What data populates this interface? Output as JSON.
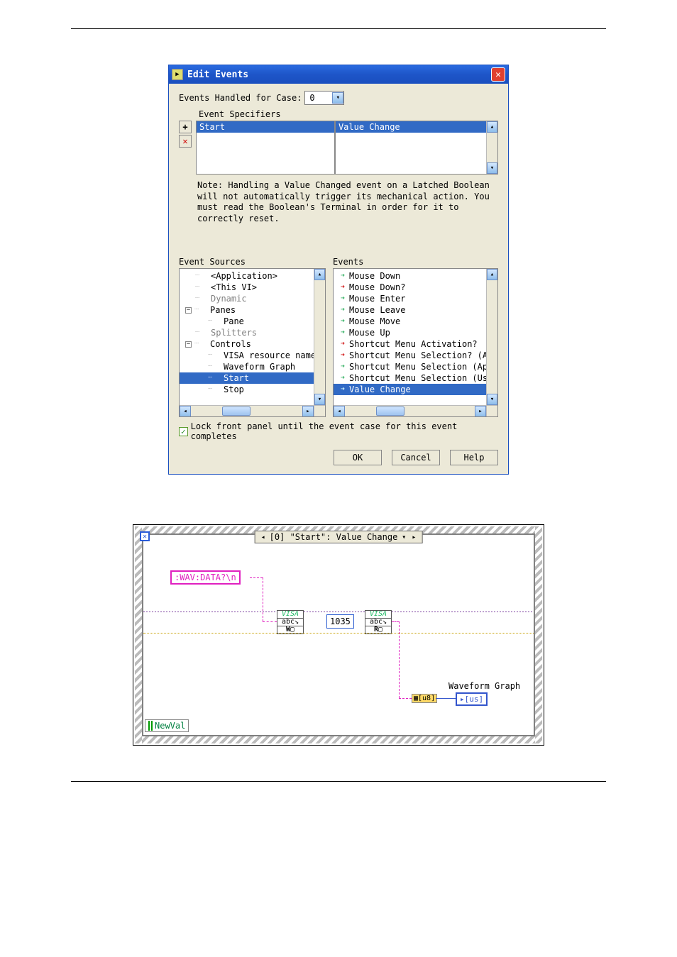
{
  "dialog": {
    "title": "Edit Events",
    "handled_label": "Events Handled for Case:",
    "case_value": "0",
    "spec_label": "Event Specifiers",
    "spec_col1": "Start",
    "spec_col2": "Value Change",
    "note": "Note:  Handling a Value Changed event on a Latched Boolean will not automatically trigger its mechanical action. You must read the Boolean's Terminal in order for it to correctly reset.",
    "sources_label": "Event Sources",
    "events_label": "Events",
    "tree": {
      "application": "<Application>",
      "this_vi": "<This VI>",
      "dynamic": "Dynamic",
      "panes": "Panes",
      "pane": "Pane",
      "splitters": "Splitters",
      "controls": "Controls",
      "visa_resource": "VISA resource name",
      "waveform_graph": "Waveform Graph",
      "start": "Start",
      "stop": "Stop"
    },
    "events": {
      "mouse_down": "Mouse Down",
      "mouse_down_q": "Mouse Down?",
      "mouse_enter": "Mouse Enter",
      "mouse_leave": "Mouse Leave",
      "mouse_move": "Mouse Move",
      "mouse_up": "Mouse Up",
      "sma": "Shortcut Menu Activation?",
      "sms_ap": "Shortcut Menu Selection? (Ap",
      "sms_app": "Shortcut Menu Selection (App",
      "sms_use": "Shortcut Menu Selection (Use",
      "value_change": "Value Change"
    },
    "lock_label": "Lock front panel until the event case for this event completes",
    "ok": "OK",
    "cancel": "Cancel",
    "help": "Help"
  },
  "bd": {
    "event_label": "[0] \"Start\": Value Change",
    "wav_cmd": ":WAV:DATA?\\n",
    "byte_count": "1035",
    "wf_graph": "Waveform Graph",
    "newval": "NewVal",
    "us": "[us]",
    "visa_w": "W",
    "visa_r": "R"
  }
}
